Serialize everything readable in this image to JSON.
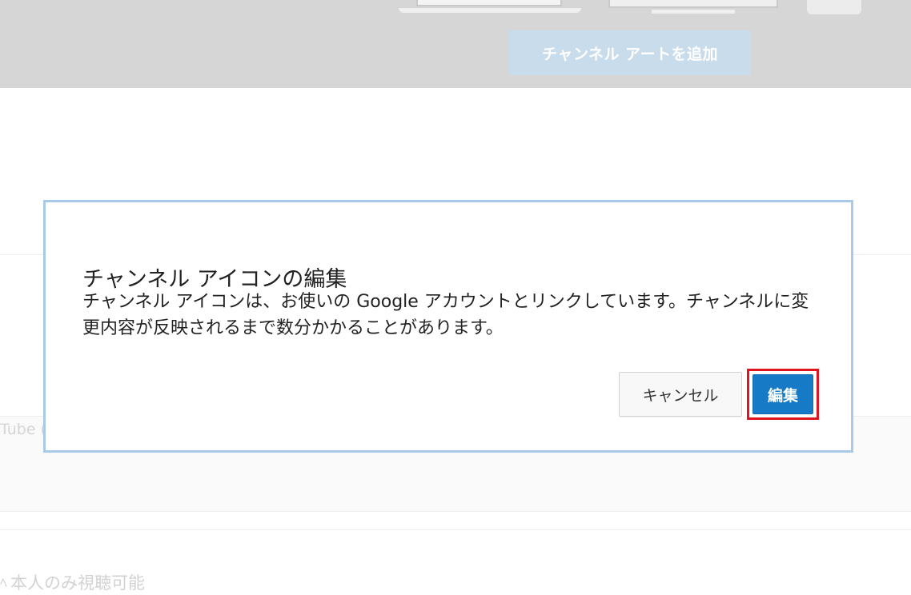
{
  "background": {
    "add_channel_art_label": "チャンネル アートを追加",
    "partial_text_left": "Tube (",
    "privacy_text": "本人のみ視聴可能",
    "privacy_icon": "lock-icon"
  },
  "dialog": {
    "title": "チャンネル アイコンの編集",
    "message": "チャンネル アイコンは、お使いの Google アカウントとリンクしています。チャンネルに変更内容が反映されるまで数分かかることがあります。",
    "cancel_label": "キャンセル",
    "edit_label": "編集"
  },
  "colors": {
    "primary_button": "#167ac6",
    "highlight_border": "#e0141e",
    "dialog_border": "#a9c9e8",
    "banner_background": "#d6d6d6"
  }
}
